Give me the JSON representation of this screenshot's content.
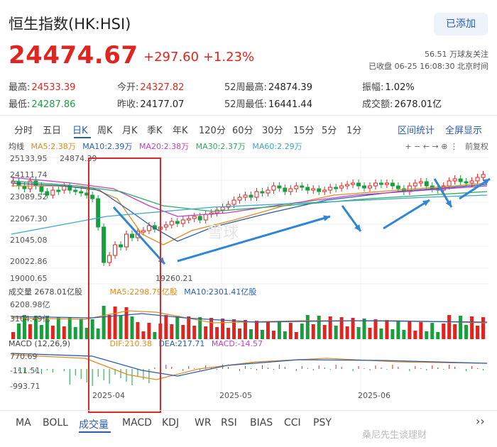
{
  "header": {
    "title": "恒生指数(HK:HSI)",
    "add_label": "已添加"
  },
  "quote": {
    "price": "24474.67",
    "change": "+297.60",
    "change_pct": "+1.23%",
    "followers": "56.51 万球友关注",
    "status": "已收盘 06-25 16:08:30 北京时间"
  },
  "stats": [
    {
      "label": "最高:",
      "value": "24533.39"
    },
    {
      "label": "今开:",
      "value": "24327.82"
    },
    {
      "label": "52周最高:",
      "value": "24874.39"
    },
    {
      "label": "振幅:",
      "value": "1.02%"
    },
    {
      "label": "最低:",
      "value": "24287.86"
    },
    {
      "label": "昨收:",
      "value": "24177.07"
    },
    {
      "label": "52周最低:",
      "value": "16441.44"
    },
    {
      "label": "成交额:",
      "value": "2678.01亿"
    }
  ],
  "tabs": [
    "分时",
    "五日",
    "日K",
    "周K",
    "月K",
    "季K",
    "年K",
    "120分",
    "60分",
    "30分",
    "15分",
    "5分",
    "1分"
  ],
  "active_tab": "日K",
  "right_tabs": [
    "区间统计",
    "全屏显示"
  ],
  "ma": {
    "label": "均线",
    "ma5": "MA5:2.38万",
    "ma10": "MA10:2.39万",
    "ma20": "MA20:2.38万",
    "ma30": "MA30:2.37万",
    "ma60": "MA60:2.29万",
    "toolbar": "+ − ← → ⊕ ⋮",
    "adjust": "前复权"
  },
  "y_labels": [
    "25133.95",
    "24111.74",
    "23089.52",
    "22067.30",
    "21045.08",
    "20022.86",
    "19000.65"
  ],
  "annotations": {
    "high": "24874.39",
    "low": "19260.21"
  },
  "volume": {
    "label": "成交量 2678.01亿股",
    "ma5": "MA5:2298.79亿股",
    "ma10": "MA10:2301.41亿股",
    "y_top": "6208.98亿",
    "y_mid": "3104.49亿"
  },
  "macd": {
    "label": "MACD (12,26,9)",
    "dif": "DIF:210.38",
    "dea": "DEA:217.71",
    "macd": "MACD:-14.57",
    "y": [
      "770.69",
      "-111.51",
      "-993.71"
    ]
  },
  "x_labels": [
    "2025-04",
    "2025-05",
    "2025-06"
  ],
  "bottom_tabs": [
    "MA",
    "BOLL",
    "成交量",
    "MACD",
    "KDJ",
    "WR",
    "RSI",
    "BIAS",
    "CCI",
    "PSY"
  ],
  "active_bottom_tab": "成交量",
  "watermark": "雪球",
  "watermark_credit": "桑尼先生谈理财",
  "colors": {
    "up": "#e0241f",
    "down": "#1b9d3f",
    "ma5": "#e08a1e",
    "ma10": "#2a5db0",
    "ma20": "#c03fc0",
    "ma30": "#2cab5d",
    "ma60": "#3aa8c8",
    "accent": "#2a5db0",
    "arrow": "#2f86d6"
  }
}
